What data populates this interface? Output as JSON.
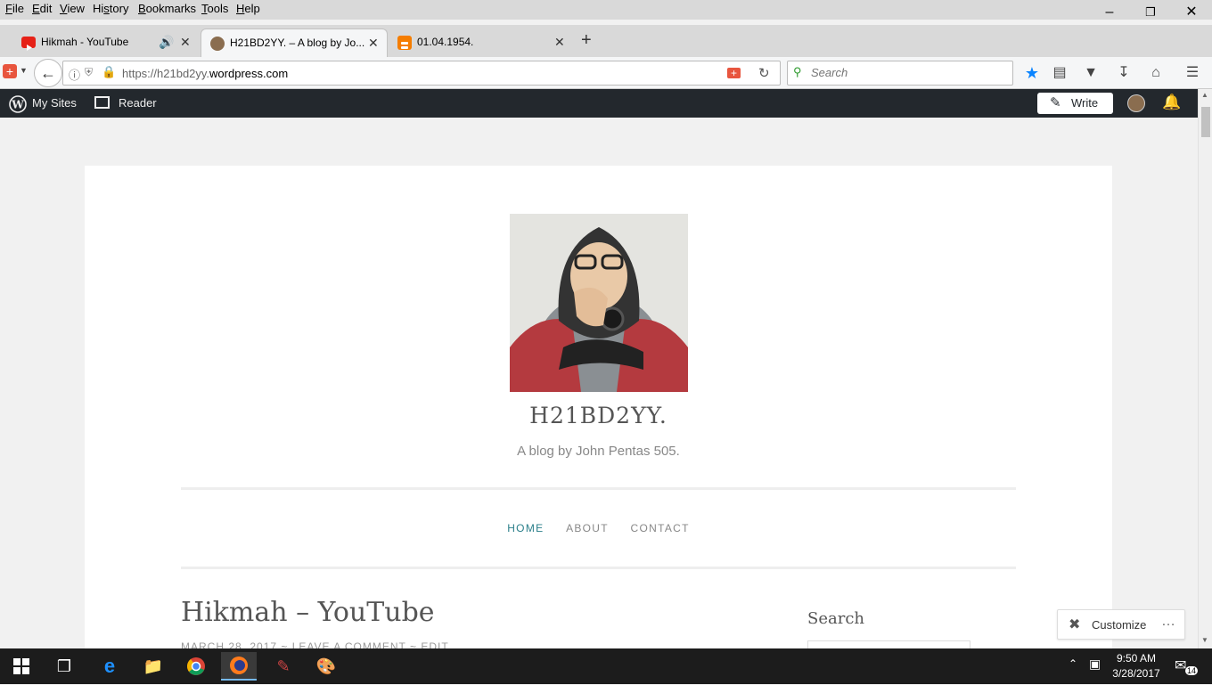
{
  "menu": [
    "File",
    "Edit",
    "View",
    "History",
    "Bookmarks",
    "Tools",
    "Help"
  ],
  "menu_accels": [
    "F",
    "E",
    "V",
    "s",
    "B",
    "T",
    "H"
  ],
  "tabs": [
    {
      "label": "Hikmah - YouTube",
      "icon": "youtube-icon",
      "color": "#e62117"
    },
    {
      "label": "H21BD2YY. – A blog by Jo...",
      "icon": "avatar-icon",
      "color": "#8a6d4f"
    },
    {
      "label": "01.04.1954.",
      "icon": "blogger-icon",
      "color": "#f57d00"
    }
  ],
  "nav": {
    "url_prefix": "https://h21bd2yy.",
    "url_domain": "wordpress.com",
    "search_placeholder": "Search"
  },
  "wpbar": {
    "my_sites": "My Sites",
    "reader": "Reader",
    "write": "Write"
  },
  "site": {
    "title": "H21BD2YY.",
    "description": "A blog by John Pentas 505.",
    "nav": [
      {
        "label": "HOME",
        "current": true
      },
      {
        "label": "ABOUT",
        "current": false
      },
      {
        "label": "CONTACT",
        "current": false
      }
    ]
  },
  "post": {
    "title": "Hikmah – YouTube",
    "meta": "MARCH 28, 2017 ~ LEAVE A COMMENT ~ EDIT"
  },
  "sidebar": {
    "search_title": "Search"
  },
  "customize": {
    "label": "Customize"
  },
  "taskbar": {
    "time": "9:50 AM",
    "date": "3/28/2017",
    "notifications": "14"
  },
  "colors": {
    "wp_bar": "#23282d",
    "nav_current": "#2b7f8a",
    "taskbar": "#1c1c1c",
    "bookmark_star": "#0a84ff"
  }
}
